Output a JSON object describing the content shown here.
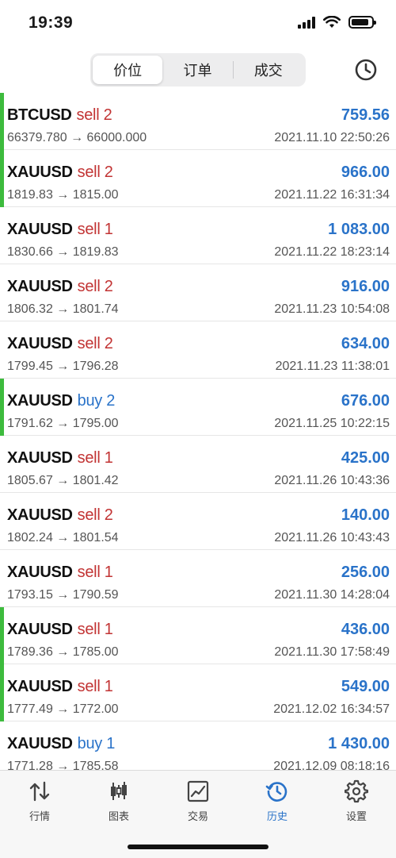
{
  "status_bar": {
    "time": "19:39"
  },
  "segments": [
    {
      "label": "价位",
      "active": true
    },
    {
      "label": "订单",
      "active": false
    },
    {
      "label": "成交",
      "active": false
    }
  ],
  "header": {
    "history_icon": "clock-icon"
  },
  "colors": {
    "sell": "#c23434",
    "buy": "#2a73c9",
    "profit": "#2a73c9",
    "marker": "#3dbb3d"
  },
  "deals": [
    {
      "symbol": "BTCUSD",
      "side": "sell",
      "side_text": "sell 2",
      "profit": "759.56",
      "prices": "66379.780 → 66000.000",
      "time": "2021.11.10 22:50:26",
      "marker": true
    },
    {
      "symbol": "XAUUSD",
      "side": "sell",
      "side_text": "sell 2",
      "profit": "966.00",
      "prices": "1819.83 → 1815.00",
      "time": "2021.11.22 16:31:34",
      "marker": true
    },
    {
      "symbol": "XAUUSD",
      "side": "sell",
      "side_text": "sell 1",
      "profit": "1 083.00",
      "prices": "1830.66 → 1819.83",
      "time": "2021.11.22 18:23:14",
      "marker": false
    },
    {
      "symbol": "XAUUSD",
      "side": "sell",
      "side_text": "sell 2",
      "profit": "916.00",
      "prices": "1806.32 → 1801.74",
      "time": "2021.11.23 10:54:08",
      "marker": false
    },
    {
      "symbol": "XAUUSD",
      "side": "sell",
      "side_text": "sell 2",
      "profit": "634.00",
      "prices": "1799.45 → 1796.28",
      "time": "2021.11.23 11:38:01",
      "marker": false
    },
    {
      "symbol": "XAUUSD",
      "side": "buy",
      "side_text": "buy 2",
      "profit": "676.00",
      "prices": "1791.62 → 1795.00",
      "time": "2021.11.25 10:22:15",
      "marker": true
    },
    {
      "symbol": "XAUUSD",
      "side": "sell",
      "side_text": "sell 1",
      "profit": "425.00",
      "prices": "1805.67 → 1801.42",
      "time": "2021.11.26 10:43:36",
      "marker": false
    },
    {
      "symbol": "XAUUSD",
      "side": "sell",
      "side_text": "sell 2",
      "profit": "140.00",
      "prices": "1802.24 → 1801.54",
      "time": "2021.11.26 10:43:43",
      "marker": false
    },
    {
      "symbol": "XAUUSD",
      "side": "sell",
      "side_text": "sell 1",
      "profit": "256.00",
      "prices": "1793.15 → 1790.59",
      "time": "2021.11.30 14:28:04",
      "marker": false
    },
    {
      "symbol": "XAUUSD",
      "side": "sell",
      "side_text": "sell 1",
      "profit": "436.00",
      "prices": "1789.36 → 1785.00",
      "time": "2021.11.30 17:58:49",
      "marker": true
    },
    {
      "symbol": "XAUUSD",
      "side": "sell",
      "side_text": "sell 1",
      "profit": "549.00",
      "prices": "1777.49 → 1772.00",
      "time": "2021.12.02 16:34:57",
      "marker": true
    },
    {
      "symbol": "XAUUSD",
      "side": "buy",
      "side_text": "buy 1",
      "profit": "1 430.00",
      "prices": "1771.28 → 1785.58",
      "time": "2021.12.09 08:18:16",
      "marker": false
    }
  ],
  "tabs": [
    {
      "label": "行情",
      "icon": "quotes-icon",
      "active": false
    },
    {
      "label": "图表",
      "icon": "candlestick-chart-icon",
      "active": false
    },
    {
      "label": "交易",
      "icon": "trade-chart-icon",
      "active": false
    },
    {
      "label": "历史",
      "icon": "history-icon",
      "active": true
    },
    {
      "label": "设置",
      "icon": "settings-gear-icon",
      "active": false
    }
  ]
}
